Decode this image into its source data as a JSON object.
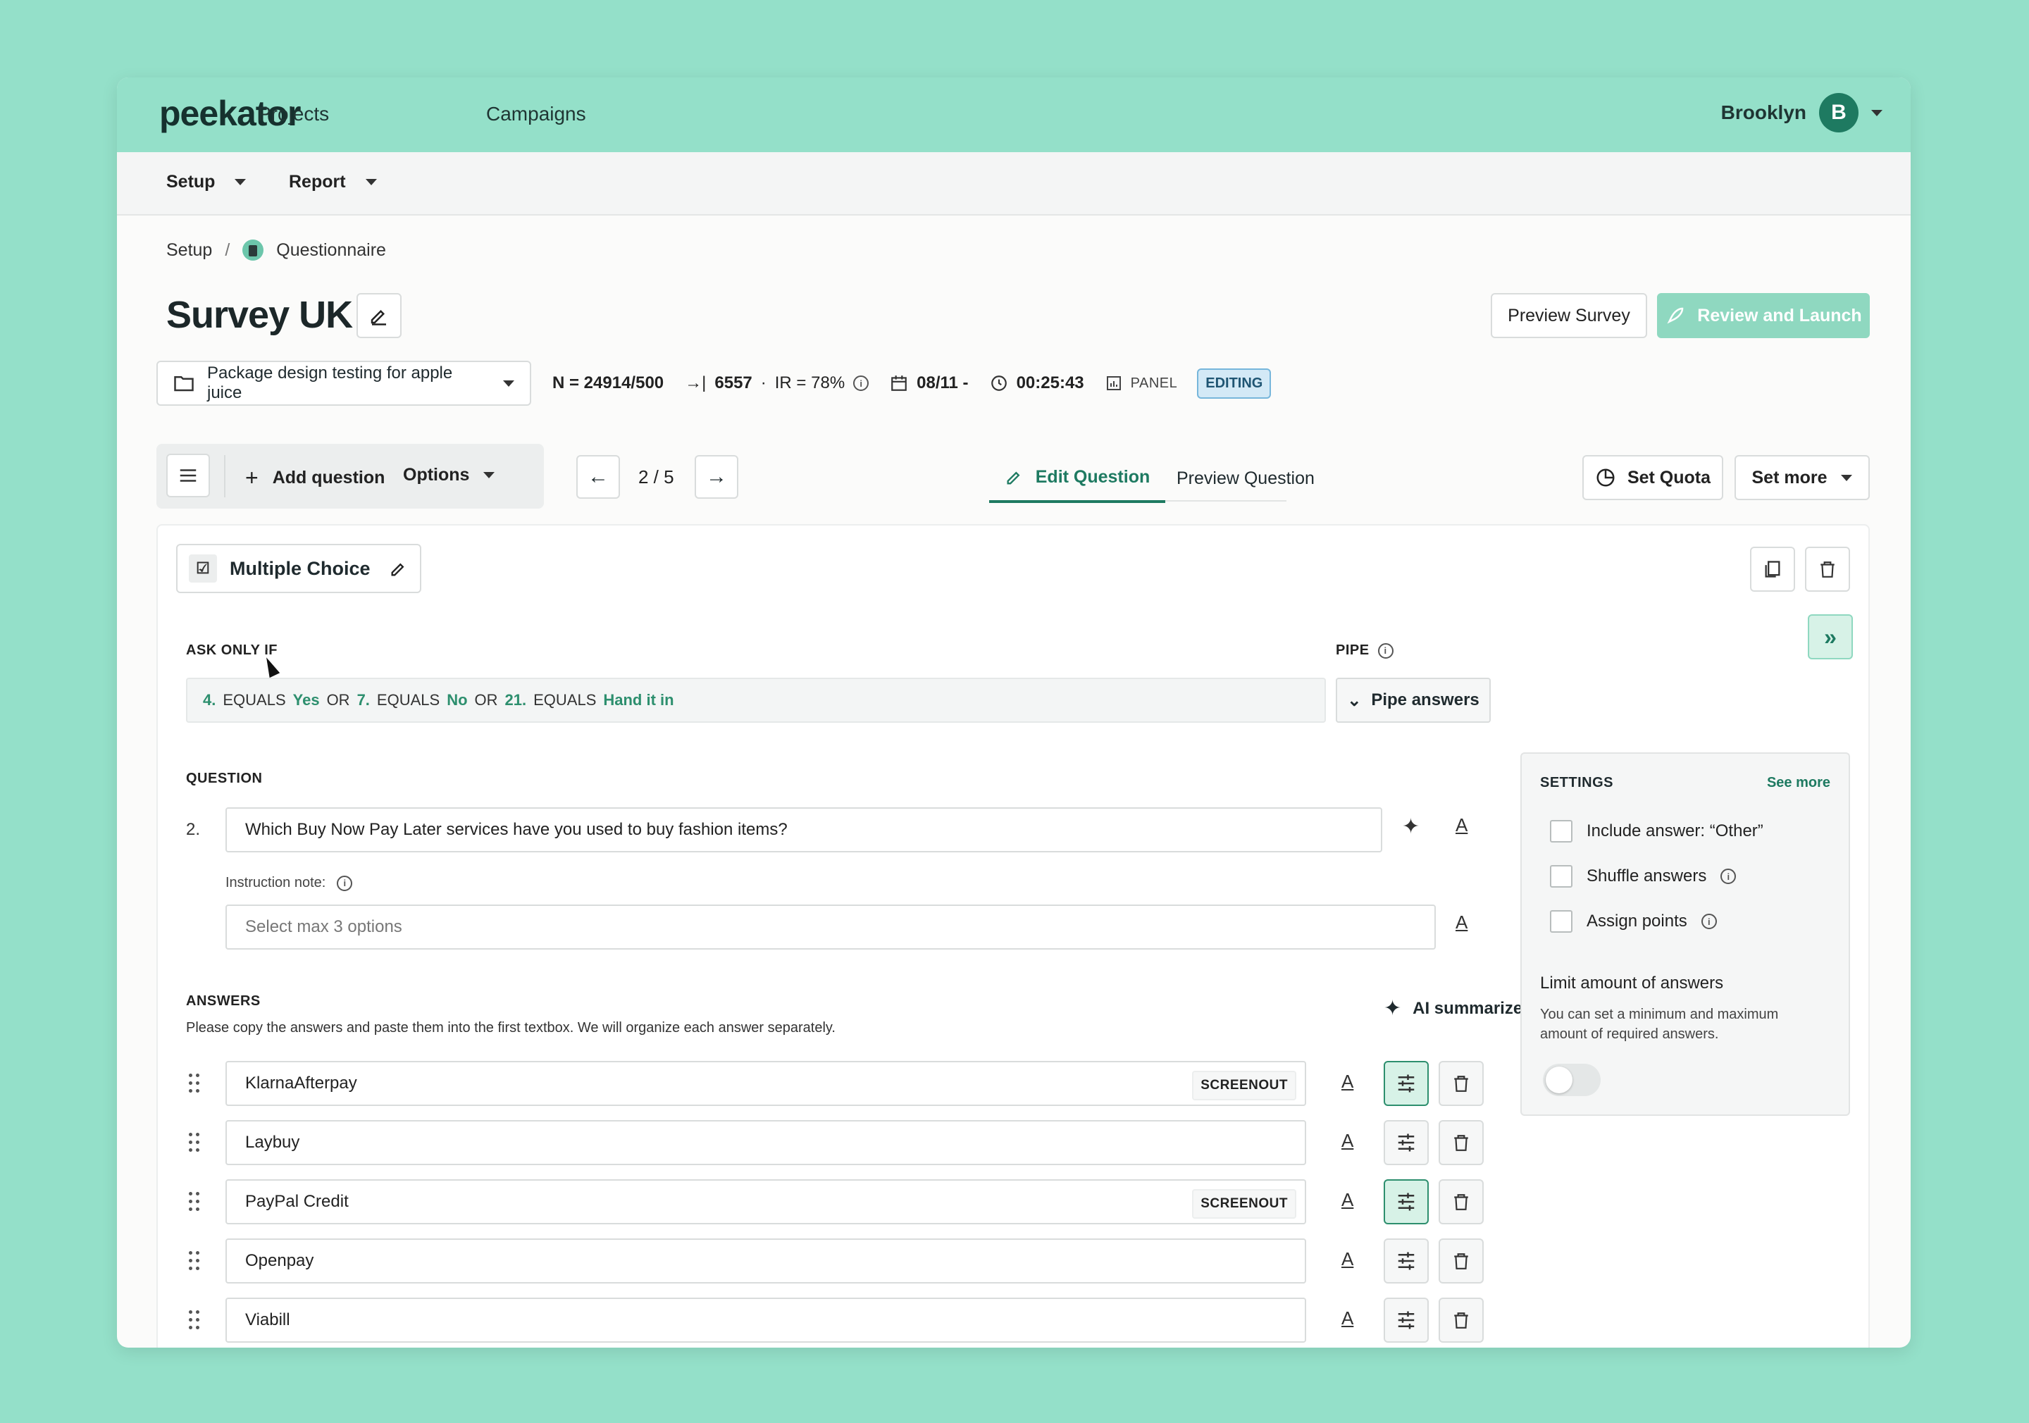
{
  "app": {
    "logo": "peekator",
    "nav": [
      "Projects",
      "Campaigns"
    ],
    "user_name": "Brooklyn",
    "user_initial": "B"
  },
  "subnav": {
    "setup": "Setup",
    "report": "Report"
  },
  "breadcrumb": {
    "root": "Setup",
    "sep": "/",
    "current": "Questionnaire"
  },
  "survey": {
    "title": "Survey UK",
    "preview_label": "Preview Survey",
    "launch_label": "Review and Launch"
  },
  "meta": {
    "project": "Package design testing for apple juice",
    "n": "N = 24914/500",
    "arrow_count": "6557",
    "dot": "·",
    "ir": "IR = 78%",
    "date": "08/11 -",
    "time": "00:25:43",
    "panel": "PANEL",
    "status": "EDITING"
  },
  "toolbar": {
    "add_question": "Add question",
    "options": "Options",
    "page": "2 / 5"
  },
  "tabs": {
    "edit": "Edit Question",
    "preview": "Preview Question"
  },
  "actions": {
    "set_quota": "Set Quota",
    "set_more": "Set more"
  },
  "question": {
    "type": "Multiple Choice",
    "ask_only_if_label": "ASK ONLY IF",
    "pipe_label": "PIPE",
    "pipe_button": "Pipe answers",
    "conditions": [
      {
        "num": "4.",
        "op": "EQUALS",
        "val": "Yes",
        "join": "OR"
      },
      {
        "num": "7.",
        "op": "EQUALS",
        "val": "No",
        "join": "OR"
      },
      {
        "num": "21.",
        "op": "EQUALS",
        "val": "Hand it in",
        "join": ""
      }
    ],
    "section_label": "QUESTION",
    "number": "2.",
    "text": "Which Buy Now Pay Later services have you used to buy fashion items?",
    "instruction_label": "Instruction note:",
    "instruction_placeholder": "Select max 3 options"
  },
  "answers": {
    "label": "ANSWERS",
    "hint": "Please copy the answers and paste them into the first textbox. We will organize each answer separately.",
    "ai_label": "AI summarize answers",
    "items": [
      {
        "text": "KlarnaAfterpay",
        "tag": "SCREENOUT",
        "active": true
      },
      {
        "text": "Laybuy",
        "tag": "",
        "active": false
      },
      {
        "text": "PayPal Credit",
        "tag": "SCREENOUT",
        "active": true
      },
      {
        "text": "Openpay",
        "tag": "",
        "active": false
      },
      {
        "text": "Viabill",
        "tag": "",
        "active": false
      }
    ]
  },
  "settings": {
    "title": "SETTINGS",
    "see_more": "See more",
    "options": [
      "Include answer: “Other”",
      "Shuffle answers",
      "Assign points"
    ],
    "limit_title": "Limit amount of answers",
    "limit_desc": "You can set a minimum and maximum amount of required answers.",
    "limit_enabled": false
  },
  "colors": {
    "brand": "#1e7a61",
    "background": "#94e0c9",
    "accent_light": "#d7f2e7",
    "badge": "#d3e9f6"
  }
}
